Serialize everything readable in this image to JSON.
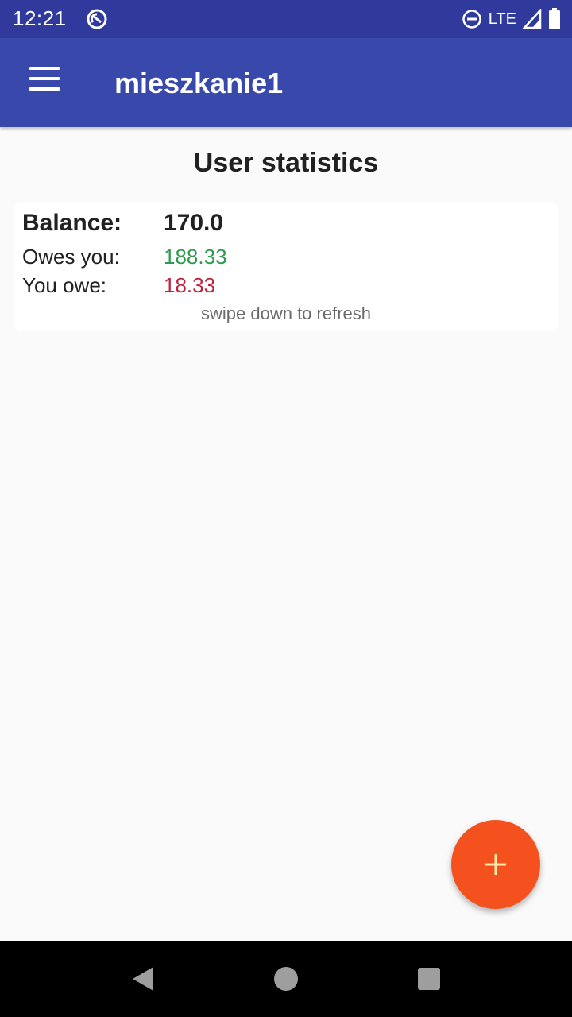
{
  "status_bar": {
    "time": "12:21",
    "network": "LTE",
    "icons": [
      "sync-icon",
      "do-not-disturb-icon",
      "signal-icon",
      "battery-icon"
    ]
  },
  "app_bar": {
    "title": "mieszkanie1",
    "menu_icon": "menu-icon"
  },
  "main": {
    "title": "User statistics",
    "stats": {
      "balance_label": "Balance:",
      "balance_value": "170.0",
      "owes_you_label": "Owes you:",
      "owes_you_value": "188.33",
      "you_owe_label": "You owe:",
      "you_owe_value": "18.33"
    },
    "refresh_hint": "swipe down to refresh"
  },
  "fab": {
    "icon": "plus-icon",
    "color": "#f4511e"
  },
  "nav_bar": {
    "icons": [
      "back-icon",
      "home-icon",
      "recents-icon"
    ]
  },
  "colors": {
    "primary": "#3949ab",
    "primary_dark": "#2f3a9c",
    "accent": "#f4511e",
    "positive": "#2e9a4b",
    "negative": "#c0213a"
  }
}
